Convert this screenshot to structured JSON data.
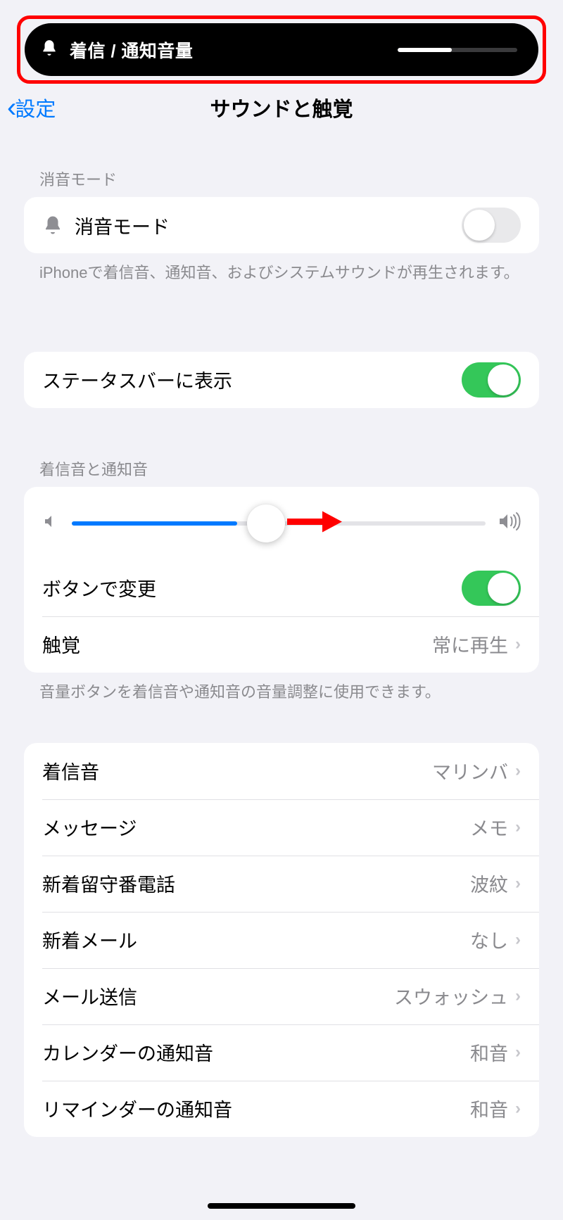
{
  "hud": {
    "label": "着信 / 通知音量",
    "level_percent": 45
  },
  "nav": {
    "back_label": "設定",
    "title": "サウンドと触覚"
  },
  "silent": {
    "header": "消音モード",
    "label": "消音モード",
    "enabled": false,
    "footer": "iPhoneで着信音、通知音、およびシステムサウンドが再生されます。"
  },
  "statusbar": {
    "label": "ステータスバーに表示",
    "enabled": true
  },
  "ringer": {
    "header": "着信音と通知音",
    "slider_percent": 40,
    "change_with_buttons_label": "ボタンで変更",
    "change_with_buttons_enabled": true,
    "haptics_label": "触覚",
    "haptics_value": "常に再生",
    "footer": "音量ボタンを着信音や通知音の音量調整に使用できます。"
  },
  "sounds": {
    "items": [
      {
        "label": "着信音",
        "value": "マリンバ"
      },
      {
        "label": "メッセージ",
        "value": "メモ"
      },
      {
        "label": "新着留守番電話",
        "value": "波紋"
      },
      {
        "label": "新着メール",
        "value": "なし"
      },
      {
        "label": "メール送信",
        "value": "スウォッシュ"
      },
      {
        "label": "カレンダーの通知音",
        "value": "和音"
      },
      {
        "label": "リマインダーの通知音",
        "value": "和音"
      }
    ]
  }
}
